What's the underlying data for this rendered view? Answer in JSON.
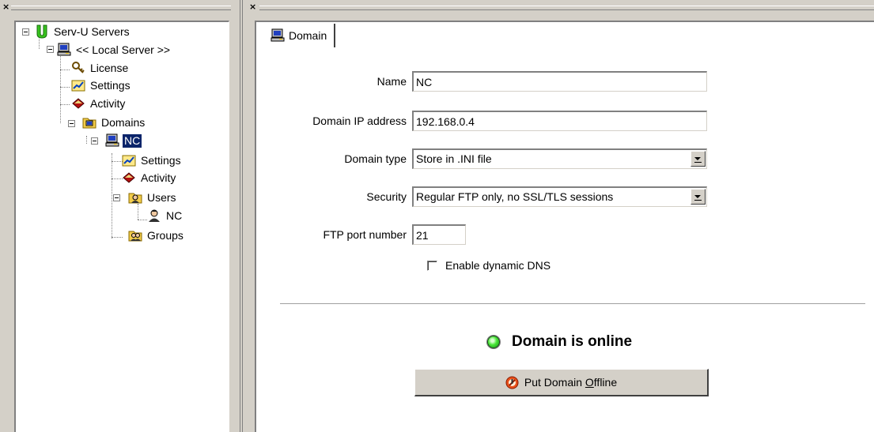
{
  "left_pane": {
    "close_glyph": "×",
    "tree": [
      {
        "id": "serv-u-servers",
        "label": "Serv-U Servers",
        "icon": "serv-u-icon"
      },
      {
        "id": "local-server",
        "label": "<< Local Server >>",
        "icon": "computer-icon"
      },
      {
        "id": "license",
        "label": "License",
        "icon": "key-icon"
      },
      {
        "id": "server-settings",
        "label": "Settings",
        "icon": "settings-icon"
      },
      {
        "id": "server-activity",
        "label": "Activity",
        "icon": "activity-icon"
      },
      {
        "id": "domains",
        "label": "Domains",
        "icon": "domains-folder-icon"
      },
      {
        "id": "domain-nc",
        "label": "NC",
        "icon": "computer-icon",
        "selected": true
      },
      {
        "id": "domain-settings",
        "label": "Settings",
        "icon": "settings-icon"
      },
      {
        "id": "domain-activity",
        "label": "Activity",
        "icon": "activity-icon"
      },
      {
        "id": "users",
        "label": "Users",
        "icon": "users-icon"
      },
      {
        "id": "user-nc",
        "label": "NC",
        "icon": "user-icon"
      },
      {
        "id": "groups",
        "label": "Groups",
        "icon": "groups-icon"
      }
    ]
  },
  "right_pane": {
    "close_glyph": "×",
    "tab": {
      "label": "Domain",
      "icon": "computer-icon"
    },
    "form": {
      "name": {
        "label": "Name",
        "value": "NC"
      },
      "ip": {
        "label": "Domain IP address",
        "value": "192.168.0.4"
      },
      "domain_type": {
        "label": "Domain type",
        "value": "Store in .INI file"
      },
      "security": {
        "label": "Security",
        "value": "Regular FTP only, no SSL/TLS sessions"
      },
      "port": {
        "label": "FTP port number",
        "value": "21"
      },
      "dynamic_dns": {
        "label": "Enable dynamic DNS",
        "checked": false
      }
    },
    "status": {
      "text": "Domain is online",
      "color": "#3fd22f"
    },
    "offline_button": {
      "label_prefix": "Put Domain ",
      "label_underlined": "O",
      "label_suffix": "ffline",
      "icon": "offline-icon"
    }
  }
}
